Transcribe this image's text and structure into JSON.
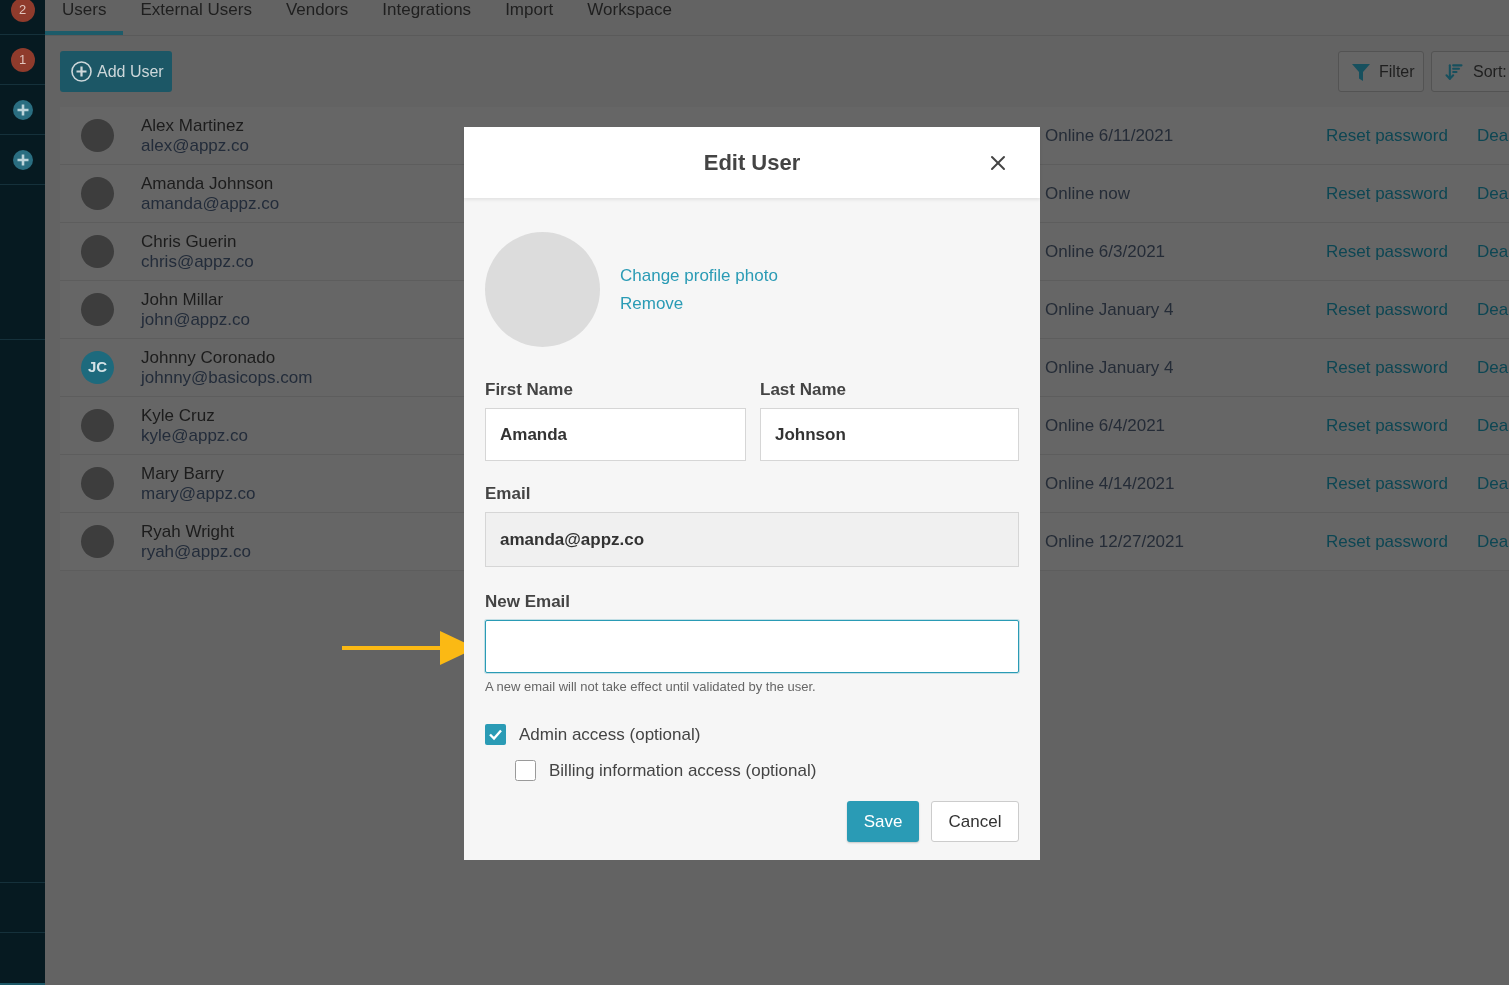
{
  "sidebar": {
    "items": [
      {
        "kind": "badge",
        "count": "2"
      },
      {
        "kind": "badge",
        "count": "1"
      },
      {
        "kind": "add"
      },
      {
        "kind": "add"
      }
    ]
  },
  "tabs": [
    {
      "label": "Users",
      "selected": true
    },
    {
      "label": "External Users",
      "selected": false
    },
    {
      "label": "Vendors",
      "selected": false
    },
    {
      "label": "Integrations",
      "selected": false
    },
    {
      "label": "Import",
      "selected": false
    },
    {
      "label": "Workspace",
      "selected": false
    }
  ],
  "toolbar": {
    "add_button": "Add User",
    "filter_button": "Filter",
    "sort_button": "Sort:"
  },
  "users": [
    {
      "name": "Alex Martinez",
      "email": "alex@appz.co",
      "avatar": {
        "kind": "photo"
      },
      "status": "Online 6/11/2021",
      "action": "Reset password",
      "column_5": "Dea"
    },
    {
      "name": "Amanda Johnson",
      "email": "amanda@appz.co",
      "avatar": {
        "kind": "photo"
      },
      "status": "Online now",
      "action": "Reset password",
      "column_5": "Dea"
    },
    {
      "name": "Chris Guerin",
      "email": "chris@appz.co",
      "avatar": {
        "kind": "photo"
      },
      "status": "Online 6/3/2021",
      "action": "Reset password",
      "column_5": "Dea"
    },
    {
      "name": "John Millar",
      "email": "john@appz.co",
      "avatar": {
        "kind": "photo"
      },
      "status": "Online January 4",
      "action": "Reset password",
      "column_5": "Dea"
    },
    {
      "name": "Johnny Coronado",
      "email": "johnny@basicops.com",
      "avatar": {
        "kind": "initials",
        "text": "JC"
      },
      "status": "Online January 4",
      "action": "Reset password",
      "column_5": "Dea"
    },
    {
      "name": "Kyle Cruz",
      "email": "kyle@appz.co",
      "avatar": {
        "kind": "photo"
      },
      "status": "Online 6/4/2021",
      "action": "Reset password",
      "column_5": "Dea"
    },
    {
      "name": "Mary Barry",
      "email": "mary@appz.co",
      "avatar": {
        "kind": "photo"
      },
      "status": "Online 4/14/2021",
      "action": "Reset password",
      "column_5": "Dea"
    },
    {
      "name": "Ryah Wright",
      "email": "ryah@appz.co",
      "avatar": {
        "kind": "photo"
      },
      "status": "Online 12/27/2021",
      "action": "Reset password",
      "column_5": "Dea"
    }
  ],
  "modal": {
    "title": "Edit User",
    "photo_links": [
      "Change profile photo",
      "Remove"
    ],
    "name_fields": [
      {
        "label": "First Name",
        "value": "Amanda"
      },
      {
        "label": "Last Name",
        "value": "Johnson"
      }
    ],
    "email_field": {
      "label": "Email",
      "value": "amanda@appz.co",
      "disabled": true
    },
    "new_email_field": {
      "label": "New Email",
      "focused": true,
      "hint": "A new email will not take effect until validated by the user."
    },
    "checkboxes": [
      {
        "label": "Admin access (optional)",
        "checked": true,
        "children": [
          {
            "label": "Billing information access (optional)",
            "checked": false
          }
        ]
      }
    ],
    "buttons": [
      {
        "label": "Save",
        "kind": "primary"
      },
      {
        "label": "Cancel",
        "kind": "secondary"
      }
    ]
  }
}
